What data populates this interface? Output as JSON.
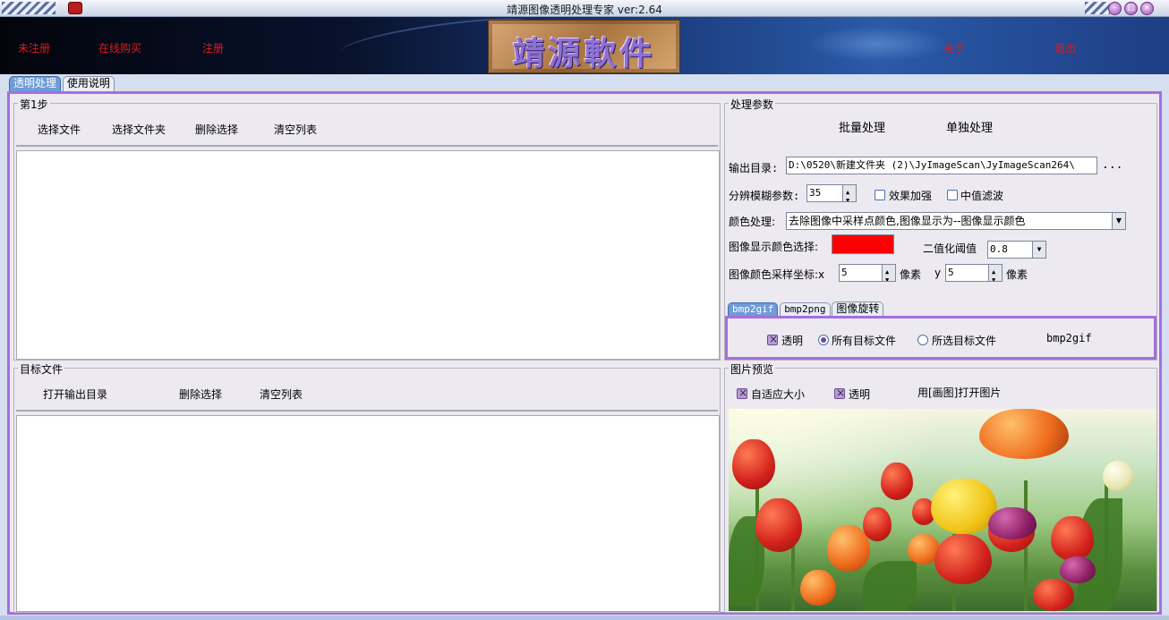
{
  "window": {
    "title": "靖源图像透明处理专家 ver:2.64"
  },
  "banner": {
    "links": {
      "unregistered": "未注册",
      "buy_online": "在线购买",
      "register": "注册",
      "about": "关于",
      "exit": "退出"
    },
    "logo_text": "靖源軟件"
  },
  "main_tabs": [
    "透明处理",
    "使用说明"
  ],
  "step1": {
    "title": "第1步",
    "buttons": {
      "select_file": "选择文件",
      "select_folder": "选择文件夹",
      "delete_selection": "删除选择",
      "clear_list": "清空列表"
    }
  },
  "target": {
    "title": "目标文件",
    "buttons": {
      "open_output": "打开输出目录",
      "delete_selection": "删除选择",
      "clear_list": "清空列表"
    }
  },
  "params": {
    "title": "处理参数",
    "batch_label": "批量处理",
    "single_label": "单独处理",
    "output_dir_label": "输出目录:",
    "output_dir_value": "D:\\0520\\新建文件夹 (2)\\JyImageScan\\JyImageScan264\\",
    "browse_label": "...",
    "blur_label": "分辨模糊参数:",
    "blur_value": "35",
    "enhance_label": "效果加强",
    "enhance_checked": false,
    "median_label": "中值滤波",
    "median_checked": false,
    "color_proc_label": "颜色处理:",
    "color_proc_value": "去除图像中采样点颜色,图像显示为--图像显示颜色",
    "display_color_label": "图像显示颜色选择:",
    "display_color": "#ff0000",
    "threshold_label": "二值化阈值",
    "threshold_value": "0.8",
    "sample_coord_label": "图像颜色采样坐标:x",
    "x_value": "5",
    "pixel_label_x": "像素",
    "y_label": "y",
    "y_value": "5",
    "pixel_label_y": "像素"
  },
  "sub_tabs": [
    "bmp2gif",
    "bmp2png",
    "图像旋转"
  ],
  "conversion": {
    "transparent_label": "透明",
    "transparent_checked": true,
    "all_targets_label": "所有目标文件",
    "all_targets_selected": true,
    "selected_targets_label": "所选目标文件",
    "selected_targets_selected": false,
    "action_label": "bmp2gif"
  },
  "preview": {
    "title": "图片预览",
    "fit_label": "自适应大小",
    "fit_checked": true,
    "transparent_label": "透明",
    "transparent_checked": true,
    "open_paint_label": "用[画图]打开图片"
  },
  "colors": {
    "accent_purple": "#a56ee0",
    "link_red": "#e21a1a",
    "tab_active": "#6f9bd8"
  }
}
